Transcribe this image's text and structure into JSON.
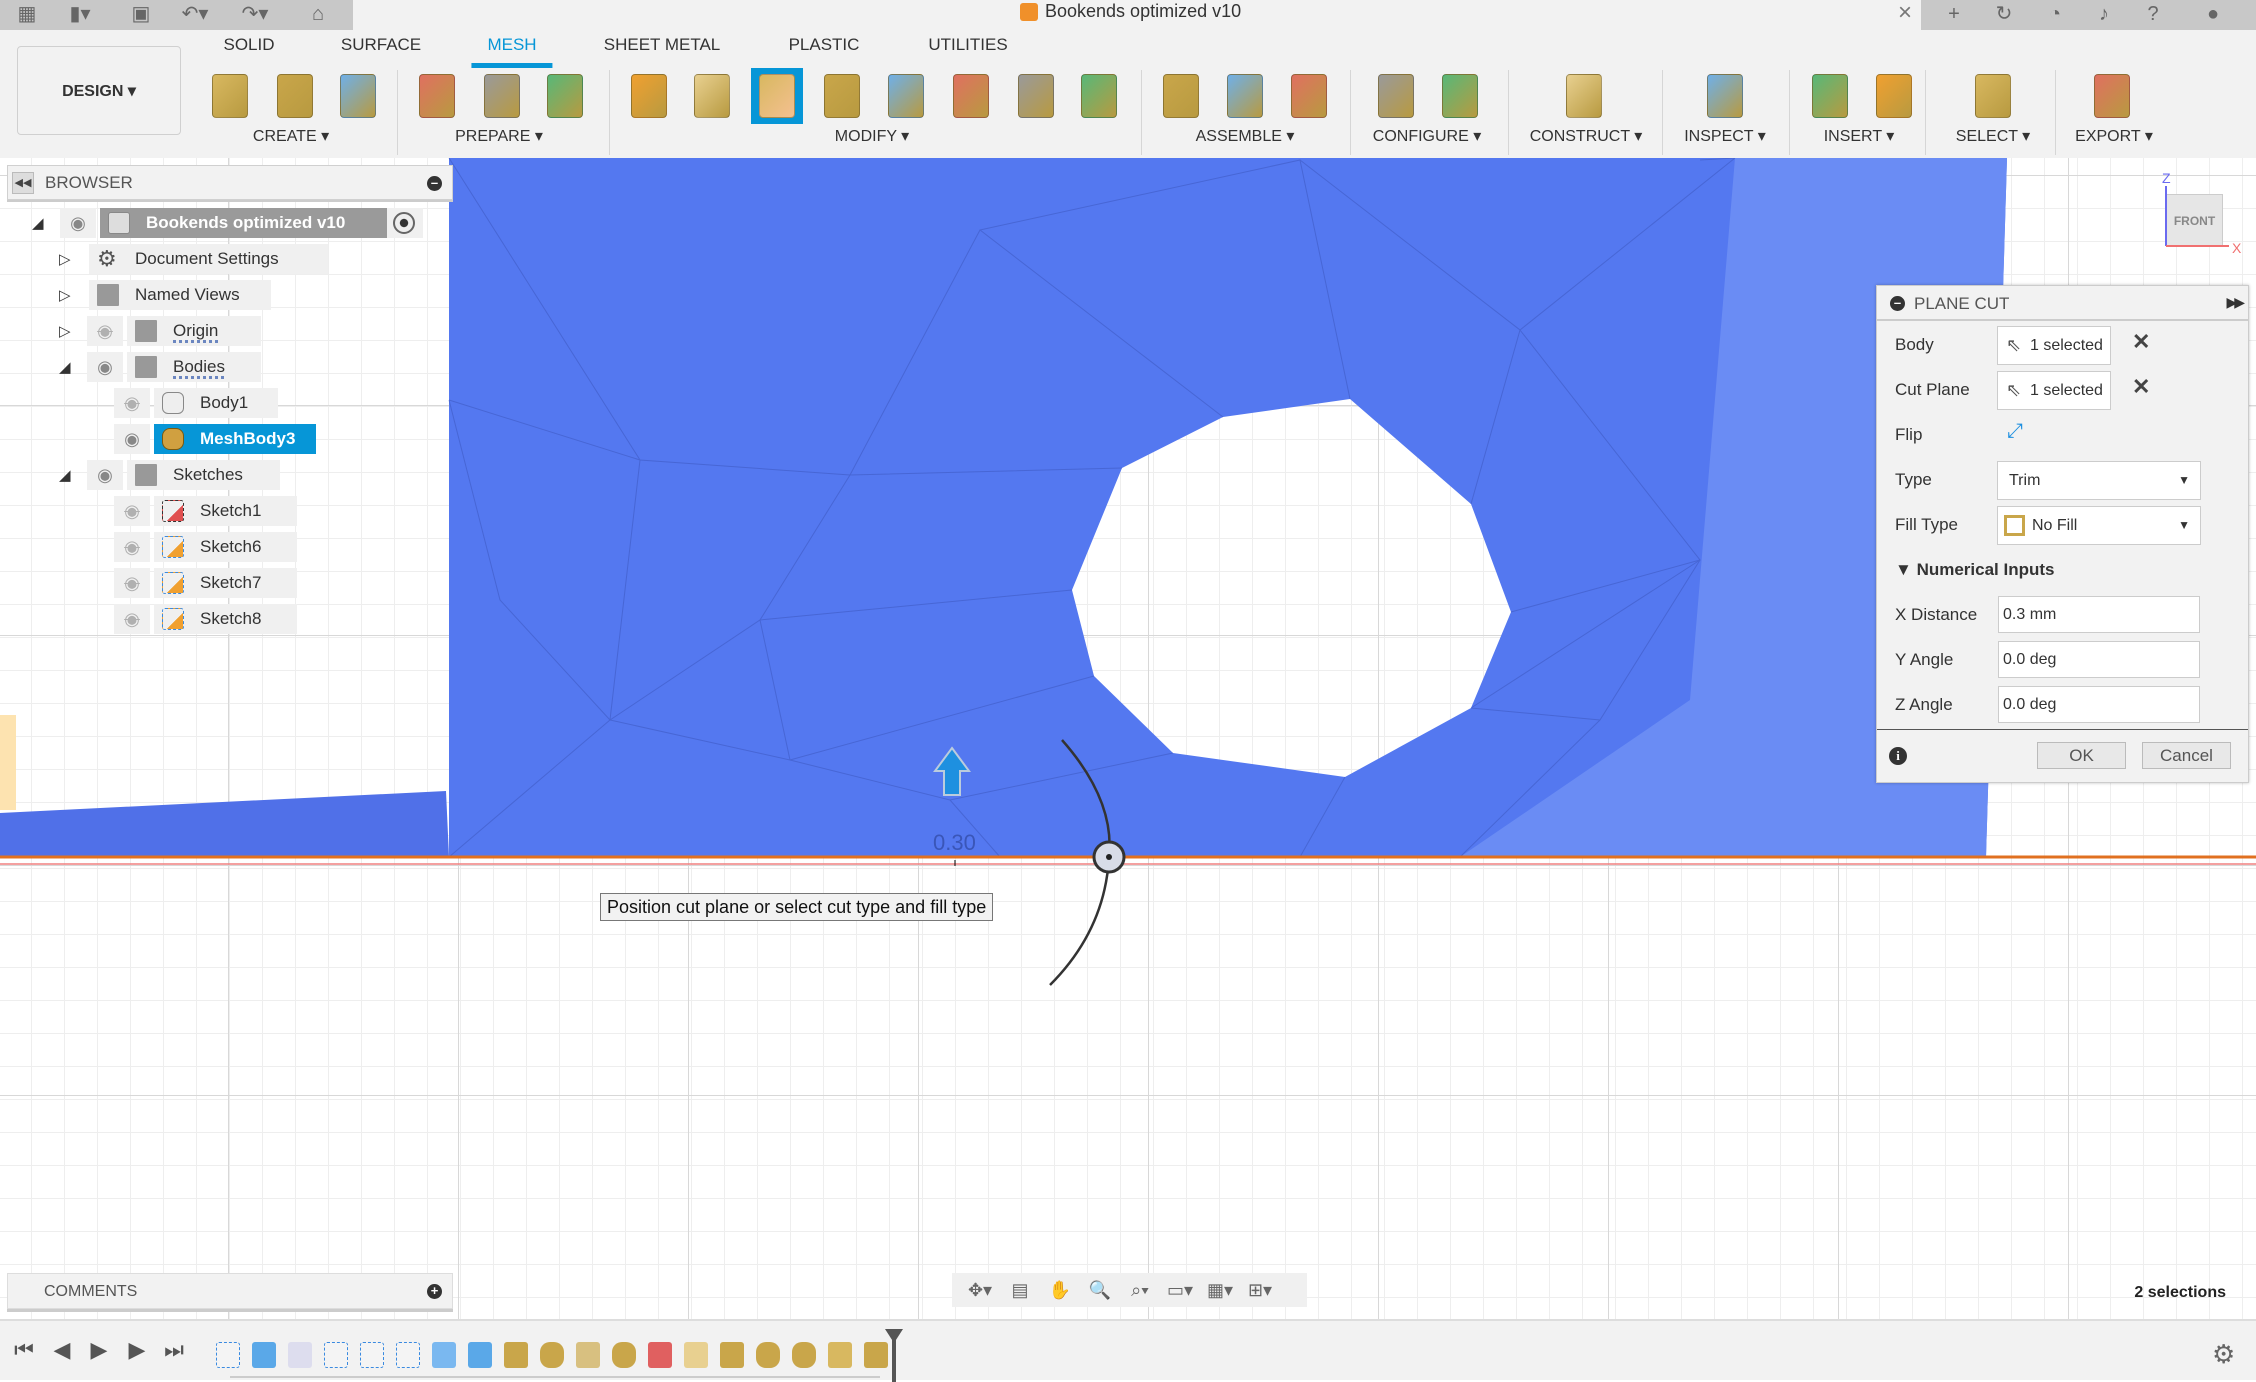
{
  "app": {
    "title": "Bookends optimized v10"
  },
  "quick_access": [
    "apps-grid-icon",
    "file-icon",
    "save-icon",
    "undo-icon",
    "redo-icon",
    "home-icon"
  ],
  "right_bar": [
    "new-tab-icon",
    "refresh-icon",
    "job-status-icon",
    "notifications-icon",
    "help-icon",
    "user-avatar-icon"
  ],
  "workspace": {
    "label": "DESIGN ▾"
  },
  "tabs": [
    {
      "label": "SOLID",
      "active": false
    },
    {
      "label": "SURFACE",
      "active": false
    },
    {
      "label": "MESH",
      "active": true
    },
    {
      "label": "SHEET METAL",
      "active": false
    },
    {
      "label": "PLASTIC",
      "active": false
    },
    {
      "label": "UTILITIES",
      "active": false
    }
  ],
  "toolbar_groups": [
    {
      "label": "CREATE ▾",
      "icons": [
        "insert-mesh-icon",
        "create-mesh-sketch-icon",
        "create-face-group-icon"
      ]
    },
    {
      "label": "PREPARE ▾",
      "icons": [
        "repair-icon",
        "generate-face-groups-icon",
        "combine-face-groups-icon"
      ]
    },
    {
      "label": "MODIFY ▾",
      "icons": [
        "remesh-icon",
        "reduce-icon",
        "plane-cut-icon",
        "shell-icon",
        "combine-icon",
        "move-icon",
        "reverse-normal-icon",
        "erase-and-fill-icon"
      ],
      "active": 2
    },
    {
      "label": "ASSEMBLE ▾",
      "icons": [
        "joint-icon",
        "new-component-icon",
        "as-built-joint-icon"
      ]
    },
    {
      "label": "CONFIGURE ▾",
      "icons": [
        "configure-model-icon",
        "configuration-table-icon"
      ]
    },
    {
      "label": "CONSTRUCT ▾",
      "icons": [
        "offset-plane-icon"
      ]
    },
    {
      "label": "INSPECT ▾",
      "icons": [
        "measure-icon"
      ]
    },
    {
      "label": "INSERT ▾",
      "icons": [
        "insert-mcmaster-icon",
        "insert-canvas-icon"
      ]
    },
    {
      "label": "SELECT ▾",
      "icons": [
        "select-icon"
      ]
    },
    {
      "label": "EXPORT ▾",
      "icons": [
        "3d-print-icon"
      ]
    }
  ],
  "browser": {
    "title": "BROWSER",
    "items": [
      {
        "label": "Bookends optimized v10",
        "level": 0,
        "expander": "expanded",
        "eye": "visible",
        "icon": "component-icon",
        "root": true
      },
      {
        "label": "Document Settings",
        "level": 1,
        "expander": "collapsed",
        "eye": null,
        "icon": "gear-icon"
      },
      {
        "label": "Named Views",
        "level": 1,
        "expander": "collapsed",
        "eye": null,
        "icon": "folder-icon"
      },
      {
        "label": "Origin",
        "level": 1,
        "expander": "collapsed",
        "eye": "hidden",
        "icon": "folder-icon",
        "wavy": true
      },
      {
        "label": "Bodies",
        "level": 1,
        "expander": "expanded",
        "eye": "visible",
        "icon": "folder-icon",
        "wavy": true
      },
      {
        "label": "Body1",
        "level": 2,
        "expander": null,
        "eye": "hidden",
        "icon": "body-icon"
      },
      {
        "label": "MeshBody3",
        "level": 2,
        "expander": null,
        "eye": "visible",
        "icon": "mesh-body-icon",
        "selected": true
      },
      {
        "label": "Sketches",
        "level": 1,
        "expander": "expanded",
        "eye": "visible",
        "icon": "folder-icon"
      },
      {
        "label": "Sketch1",
        "level": 2,
        "expander": null,
        "eye": "hidden",
        "icon": "locked-sketch-icon"
      },
      {
        "label": "Sketch6",
        "level": 2,
        "expander": null,
        "eye": "hidden",
        "icon": "sketch-icon"
      },
      {
        "label": "Sketch7",
        "level": 2,
        "expander": null,
        "eye": "hidden",
        "icon": "sketch-icon"
      },
      {
        "label": "Sketch8",
        "level": 2,
        "expander": null,
        "eye": "hidden",
        "icon": "sketch-icon"
      }
    ]
  },
  "comments": {
    "title": "COMMENTS"
  },
  "viewport": {
    "dimension": "0.30",
    "tooltip": "Position cut plane or select cut type and fill type",
    "viewcube": {
      "face": "FRONT",
      "z": "Z",
      "x": "X"
    },
    "mesh_color": "#5478f0"
  },
  "plane_cut": {
    "title": "PLANE CUT",
    "body_label": "Body",
    "body_value": "1 selected",
    "cut_plane_label": "Cut Plane",
    "cut_plane_value": "1 selected",
    "flip_label": "Flip",
    "type_label": "Type",
    "type_value": "Trim",
    "fill_type_label": "Fill Type",
    "fill_type_value": "No Fill",
    "numerical_label": "Numerical Inputs",
    "x_distance_label": "X Distance",
    "x_distance_value": "0.3 mm",
    "y_angle_label": "Y Angle",
    "y_angle_value": "0.0 deg",
    "z_angle_label": "Z Angle",
    "z_angle_value": "0.0 deg",
    "ok": "OK",
    "cancel": "Cancel"
  },
  "nav_toolbar": [
    "orbit-icon",
    "look-at-icon",
    "pan-icon",
    "zoom-icon",
    "fit-icon",
    "display-settings-icon",
    "grid-settings-icon",
    "viewports-icon"
  ],
  "status": {
    "selections": "2 selections"
  },
  "timeline": {
    "controls": [
      "first-icon",
      "previous-icon",
      "play-icon",
      "next-icon",
      "last-icon"
    ],
    "features": [
      "sketch",
      "extrude",
      "fillet",
      "sketch",
      "sketch",
      "sketch",
      "loft",
      "extrude",
      "mesh-new",
      "mesh",
      "remesh",
      "mesh",
      "face-groups",
      "reduce",
      "mesh-offset",
      "mesh",
      "mesh",
      "combine",
      "repair"
    ]
  },
  "colors": {
    "accent": "#0696d7",
    "mesh": "#5478f0",
    "cut_plane": "#e07020"
  }
}
